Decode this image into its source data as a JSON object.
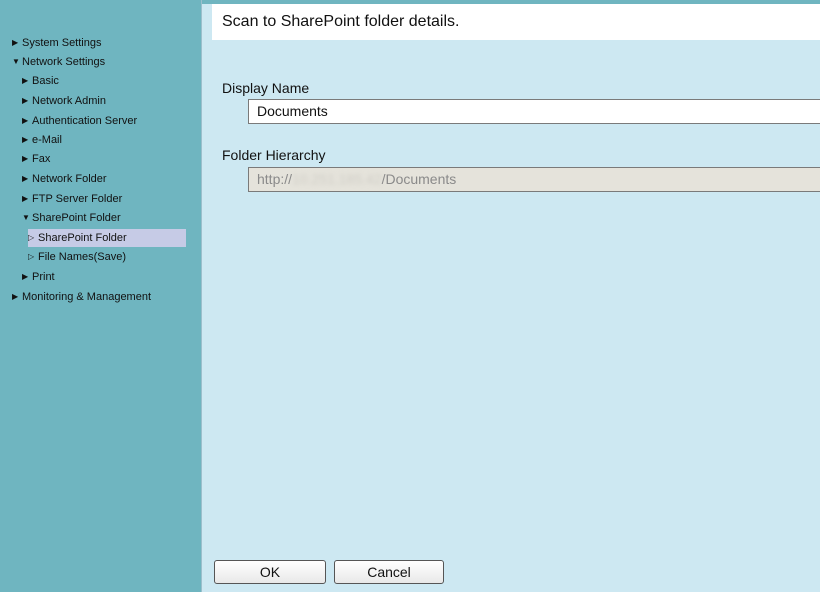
{
  "sidebar": {
    "items": [
      {
        "label": "System Settings",
        "expanded": false
      },
      {
        "label": "Network Settings",
        "expanded": true
      },
      {
        "label": "Basic",
        "expanded": false
      },
      {
        "label": "Network Admin",
        "expanded": false
      },
      {
        "label": "Authentication Server",
        "expanded": false
      },
      {
        "label": "e-Mail",
        "expanded": false
      },
      {
        "label": "Fax",
        "expanded": false
      },
      {
        "label": "Network Folder",
        "expanded": false
      },
      {
        "label": "FTP Server Folder",
        "expanded": false
      },
      {
        "label": "SharePoint Folder",
        "expanded": true
      },
      {
        "label": "SharePoint Folder",
        "selected": true
      },
      {
        "label": "File Names(Save)"
      },
      {
        "label": "Print",
        "expanded": false
      },
      {
        "label": "Monitoring & Management",
        "expanded": false
      }
    ]
  },
  "main": {
    "title": "Scan to SharePoint folder details.",
    "display_name": {
      "label": "Display Name",
      "value": "Documents"
    },
    "folder_hierarchy": {
      "label": "Folder Hierarchy",
      "prefix": "http://",
      "host_redacted": "10.251.185.42",
      "suffix": "/Documents"
    }
  },
  "footer": {
    "ok_label": "OK",
    "cancel_label": "Cancel"
  },
  "colors": {
    "sidebar_bg": "#6fb5c0",
    "content_bg": "#cde8f2",
    "selected_bg": "#c6cbe6",
    "readonly_bg": "#e5e3db"
  }
}
